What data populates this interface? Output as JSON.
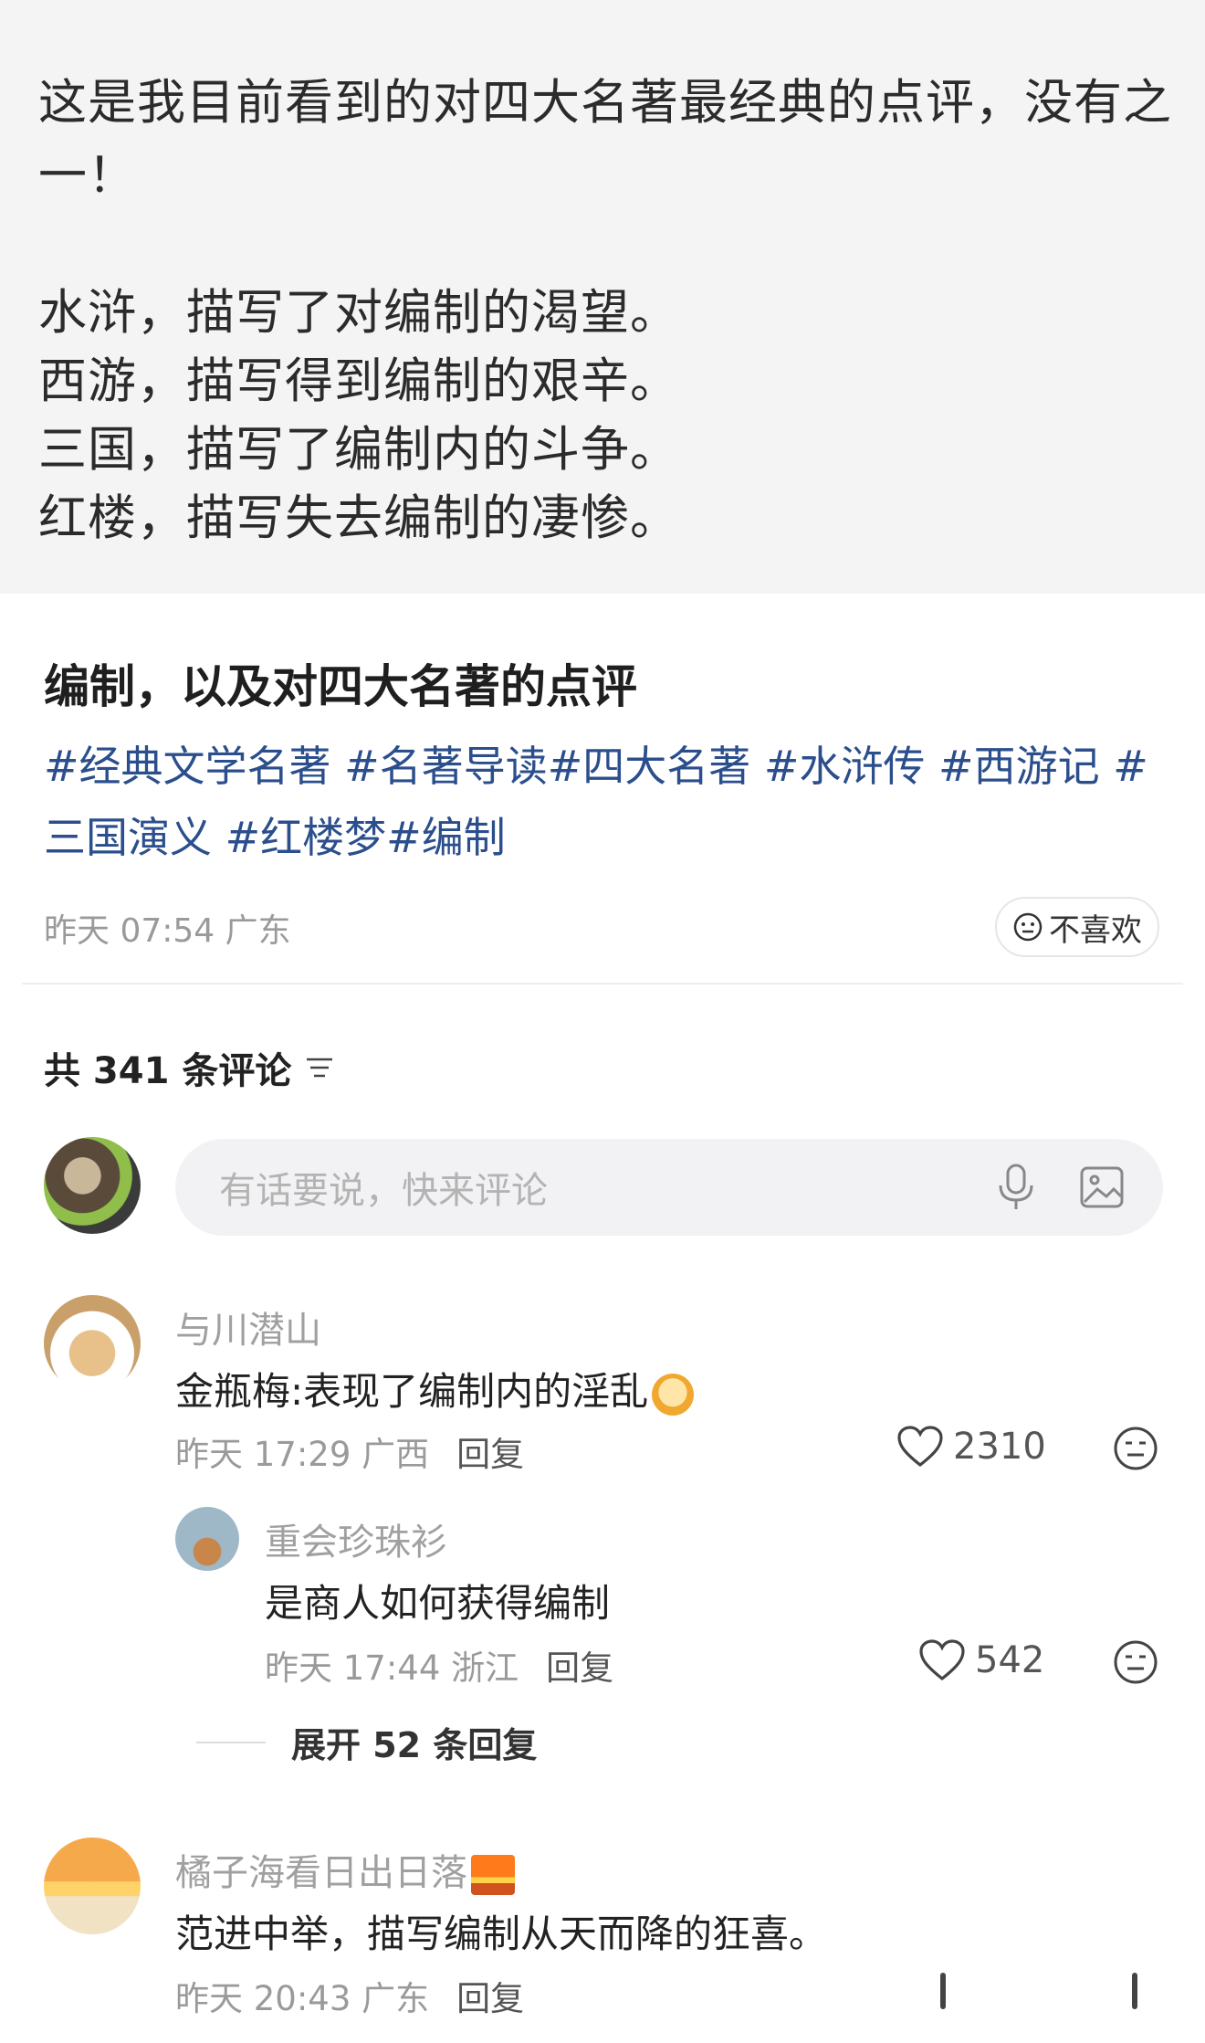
{
  "quote": {
    "lines": [
      "这是我目前看到的对四大名著最经典的点评，没有之",
      "一！",
      "水浒，描写了对编制的渴望。",
      "西游，描写得到编制的艰辛。",
      "三国，描写了编制内的斗争。",
      "红楼，描写失去编制的凄惨。"
    ]
  },
  "post": {
    "title": "编制，以及对四大名著的点评",
    "tags_line1": "#经典文学名著 #名著导读#四大名著 #水浒传 #西游记 #",
    "tags_line2": "三国演义 #红楼梦#编制",
    "meta": "昨天 07:54 广东",
    "dislike_label": "不喜欢"
  },
  "comments_header": {
    "count_label": "共 341 条评论"
  },
  "comment_input": {
    "placeholder": "有话要说，快来评论"
  },
  "comments": [
    {
      "username": "与川潜山",
      "text": "金瓶梅:表现了编制内的淫乱",
      "time": "昨天 17:29 广西",
      "reply_label": "回复",
      "likes": "2310"
    },
    {
      "username": "重会珍珠衫",
      "text": "是商人如何获得编制",
      "time": "昨天 17:44 浙江",
      "reply_label": "回复",
      "likes": "542"
    },
    {
      "username": "橘子海看日出日落",
      "text": "范进中举，描写编制从天而降的狂喜。",
      "time": "昨天 20:43 广东",
      "reply_label": "回复"
    }
  ],
  "expand_replies": "展开 52 条回复",
  "colors": {
    "tag": "#2b4e8c",
    "muted": "#9a9a9a",
    "input_bg": "#f2f2f4"
  },
  "icons": [
    "smiley-neutral-icon",
    "filter-icon",
    "mic-icon",
    "image-icon",
    "heart-icon",
    "meh-face-icon"
  ]
}
